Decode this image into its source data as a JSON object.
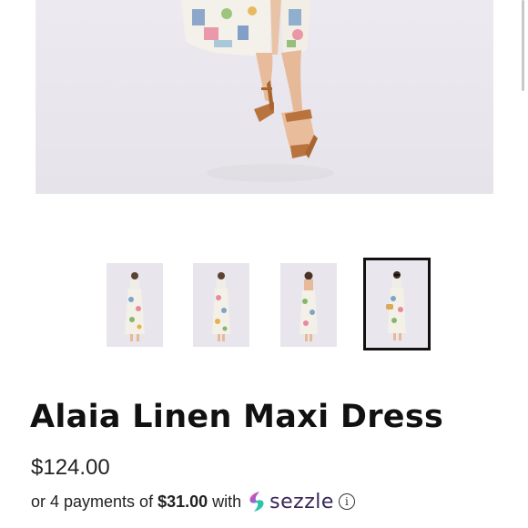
{
  "product": {
    "title": "Alaia Linen Maxi Dress",
    "price": "$124.00"
  },
  "payment": {
    "prefix": "or 4 payments of",
    "amount": "$31.00",
    "connector": "with",
    "provider_name": "sezzle",
    "provider_icon": "sezzle-logo-icon",
    "info_icon": "info-icon"
  },
  "gallery": {
    "thumbnail_count": 4,
    "selected_index": 3
  },
  "colors": {
    "text": "#111111",
    "sezzle_brand": "#382757",
    "selected_border": "#111111"
  }
}
